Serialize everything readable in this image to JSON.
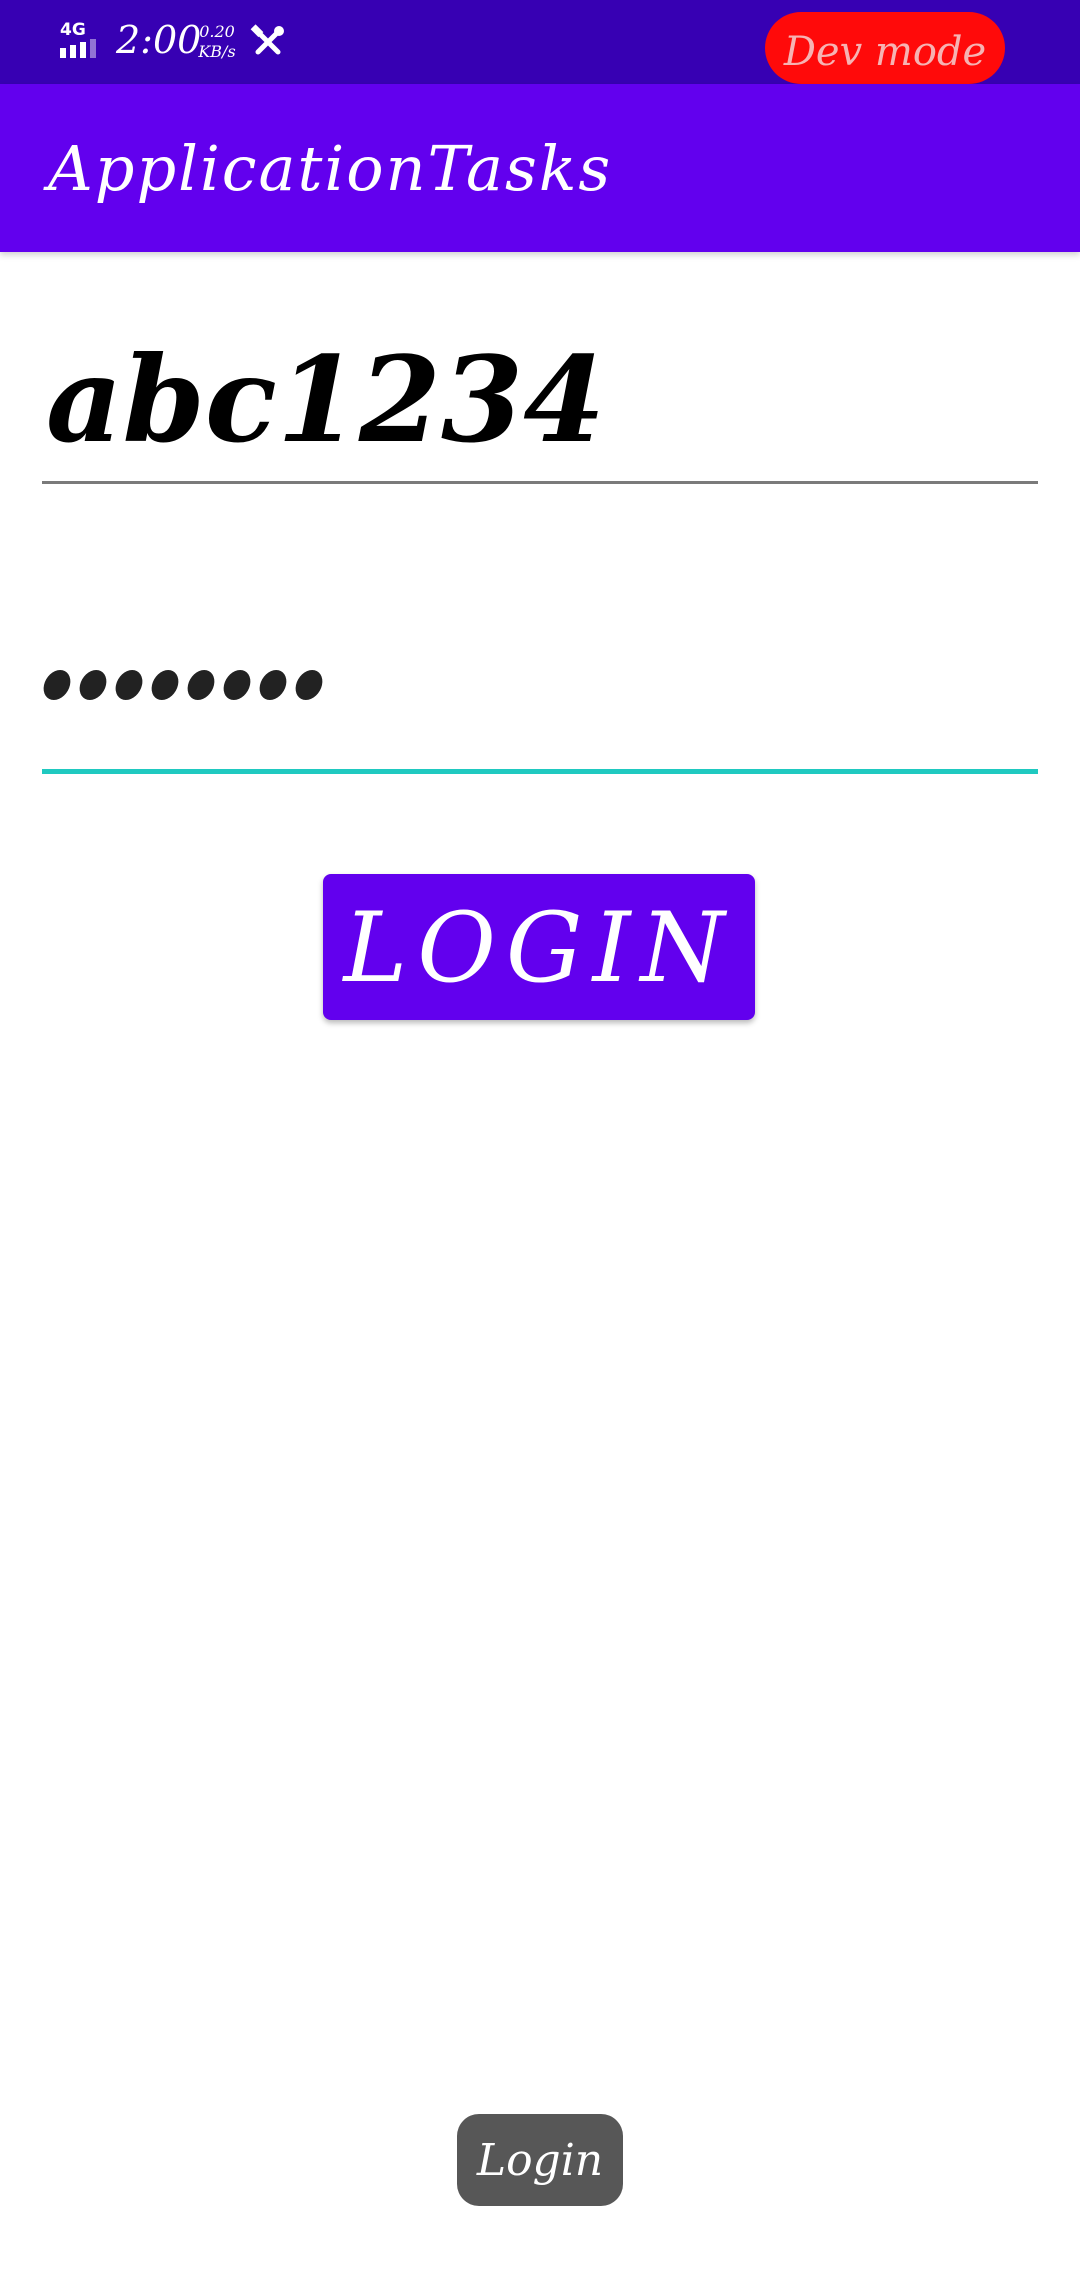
{
  "status_bar": {
    "network_type": "4G",
    "time": "2:00",
    "speed_value": "0.20",
    "speed_unit": "KB/s",
    "icons": [
      "signal-icon",
      "tools-icon"
    ],
    "dev_mode_label": "Dev mode",
    "background_color": "#3700b3",
    "dev_mode_color": "#ff0a0a"
  },
  "app_bar": {
    "title": "ApplicationTasks",
    "background_color": "#6200ee"
  },
  "form": {
    "username_value": "abc1234",
    "password_masked": "••••••••",
    "password_length": 8,
    "password_focus_color": "#1fc9c0",
    "login_label": "LOGIN",
    "button_color": "#6200ee"
  },
  "toast": {
    "message": "Login"
  }
}
